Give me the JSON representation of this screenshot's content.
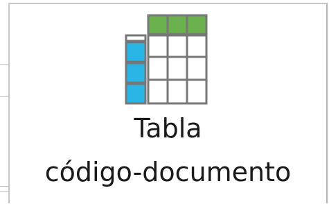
{
  "button": {
    "label_line1": "Tabla",
    "label_line2": "código-documento",
    "icon": "table-icon"
  },
  "colors": {
    "header_green": "#6ab04c",
    "row_header_blue": "#29b6e6",
    "grid_gray": "#777777"
  }
}
